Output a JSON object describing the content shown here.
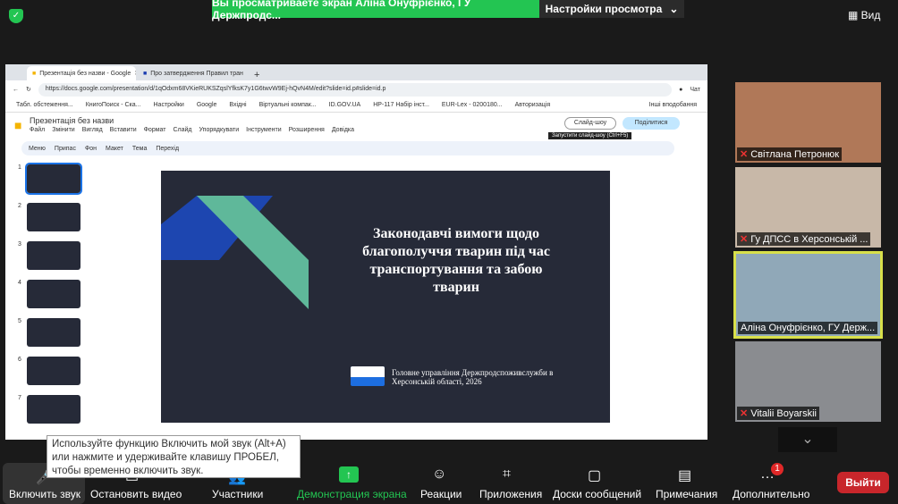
{
  "zoom": {
    "banner_text": "Вы просматриваете экран Аліна Онуфрієнко, ГУ Держпродс...",
    "view_settings": "Настройки просмотра",
    "view_label": "Вид",
    "tooltip": "Используйте функцию Включить мой звук (Alt+A) или нажмите и удерживайте клавишу ПРОБЕЛ, чтобы временно включить звук.",
    "toolbar": [
      {
        "label": "Включить звук",
        "icon": "mic-muted-icon"
      },
      {
        "label": "Остановить видео",
        "icon": "video-icon"
      },
      {
        "label": "Участники",
        "icon": "participants-icon"
      },
      {
        "label": "Демонстрация экрана",
        "icon": "share-screen-icon"
      },
      {
        "label": "Реакции",
        "icon": "reactions-icon"
      },
      {
        "label": "Приложения",
        "icon": "apps-icon"
      },
      {
        "label": "Доски сообщений",
        "icon": "whiteboard-icon"
      },
      {
        "label": "Примечания",
        "icon": "notes-icon"
      },
      {
        "label": "Дополнительно",
        "icon": "more-icon",
        "badge": "1"
      }
    ],
    "leave": "Выйти",
    "participants": [
      "Світлана Петронюк",
      "Гу ДПСС в Херсонській ...",
      "Аліна Онуфрієнко, ГУ Держ...",
      "Vitalii Boyarskii"
    ]
  },
  "browser": {
    "tabs": [
      "Презентація без назви - Google",
      "Про затвердження Правил тран"
    ],
    "url": "https://docs.google.com/presentation/d/1qOdxm68VKieRUKSZqslYfksK7y1G6twvW9Ej-hQvN4M/edit?slide=id.p#slide=id.p",
    "chat": "Чат",
    "bookmarks": [
      "Табл. обстеження...",
      "КнигоПоиск - Ска...",
      "Настройки",
      "Google",
      "Вхідні",
      "Віртуальні компак...",
      "ID.GOV.UA",
      "HP-117 Набір інст...",
      "EUR-Lex - 0200180...",
      "Авторизація"
    ],
    "other_bookmarks": "Інші вподобання"
  },
  "slides": {
    "title": "Презентація без назви",
    "menu": [
      "Файл",
      "Змінити",
      "Вигляд",
      "Вставити",
      "Формат",
      "Слайд",
      "Упорядкувати",
      "Інструменти",
      "Розширення",
      "Довідка"
    ],
    "toolbar": [
      "Меню",
      "Припас",
      "Фон",
      "Макет",
      "Тема",
      "Перехід"
    ],
    "slideshow": "Слайд-шоу",
    "share": "Поділитися",
    "tooltip": "Запустити слайд-шоу (Ctrl+F5)",
    "thumb_numbers": [
      "1",
      "2",
      "3",
      "4",
      "5",
      "6",
      "7"
    ],
    "slide_title": "Законодавчі вимоги щодо благополуччя тварин під час транспортування та забою тварин",
    "slide_caption": "Головне управління Держпродспоживслужби в Херсонській області, 2026"
  }
}
